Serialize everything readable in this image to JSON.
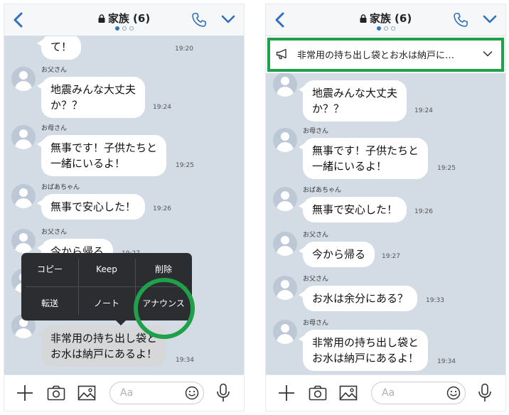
{
  "chat": {
    "title": "家族 (6)"
  },
  "left": {
    "partial": {
      "text": "て！",
      "time": "19:20"
    },
    "messages": [
      {
        "sender": "お父さん",
        "text": "地震みんな大丈夫\nか？？",
        "time": "19:24"
      },
      {
        "sender": "お母さん",
        "text": "無事です！子供たちと\n一緒にいるよ！",
        "time": "19:25"
      },
      {
        "sender": "おばあちゃん",
        "text": "無事で安心した！",
        "time": "19:26"
      },
      {
        "sender": "お父さん",
        "text": "今から帰る",
        "time": "19:27"
      },
      {
        "text": "非常用の持ち出し袋と\nお水は納戸にあるよ！",
        "time": "19:34"
      }
    ],
    "menu": {
      "copy": "コピー",
      "keep": "Keep",
      "delete": "削除",
      "forward": "転送",
      "note": "ノート",
      "announce": "アナウンス"
    }
  },
  "right": {
    "announcement": "非常用の持ち出し袋とお水は納戸に…",
    "messages": [
      {
        "text": "地震みんな大丈夫\nか？？",
        "time": "19:24"
      },
      {
        "sender": "お母さん",
        "text": "無事です！子供たちと\n一緒にいるよ！",
        "time": "19:25"
      },
      {
        "sender": "おばあちゃん",
        "text": "無事で安心した！",
        "time": "19:26"
      },
      {
        "sender": "お父さん",
        "text": "今から帰る",
        "time": "19:27"
      },
      {
        "sender": "お父さん",
        "text": "お水は余分にある？",
        "time": "19:33"
      },
      {
        "sender": "お母さん",
        "text": "非常用の持ち出し袋と\nお水は納戸にあるよ！",
        "time": "19:34"
      }
    ]
  },
  "input": {
    "placeholder": "Aa"
  },
  "colors": {
    "accent": "#2f6fc0",
    "highlight": "#1fa04a",
    "background": "#d3dbe5"
  }
}
